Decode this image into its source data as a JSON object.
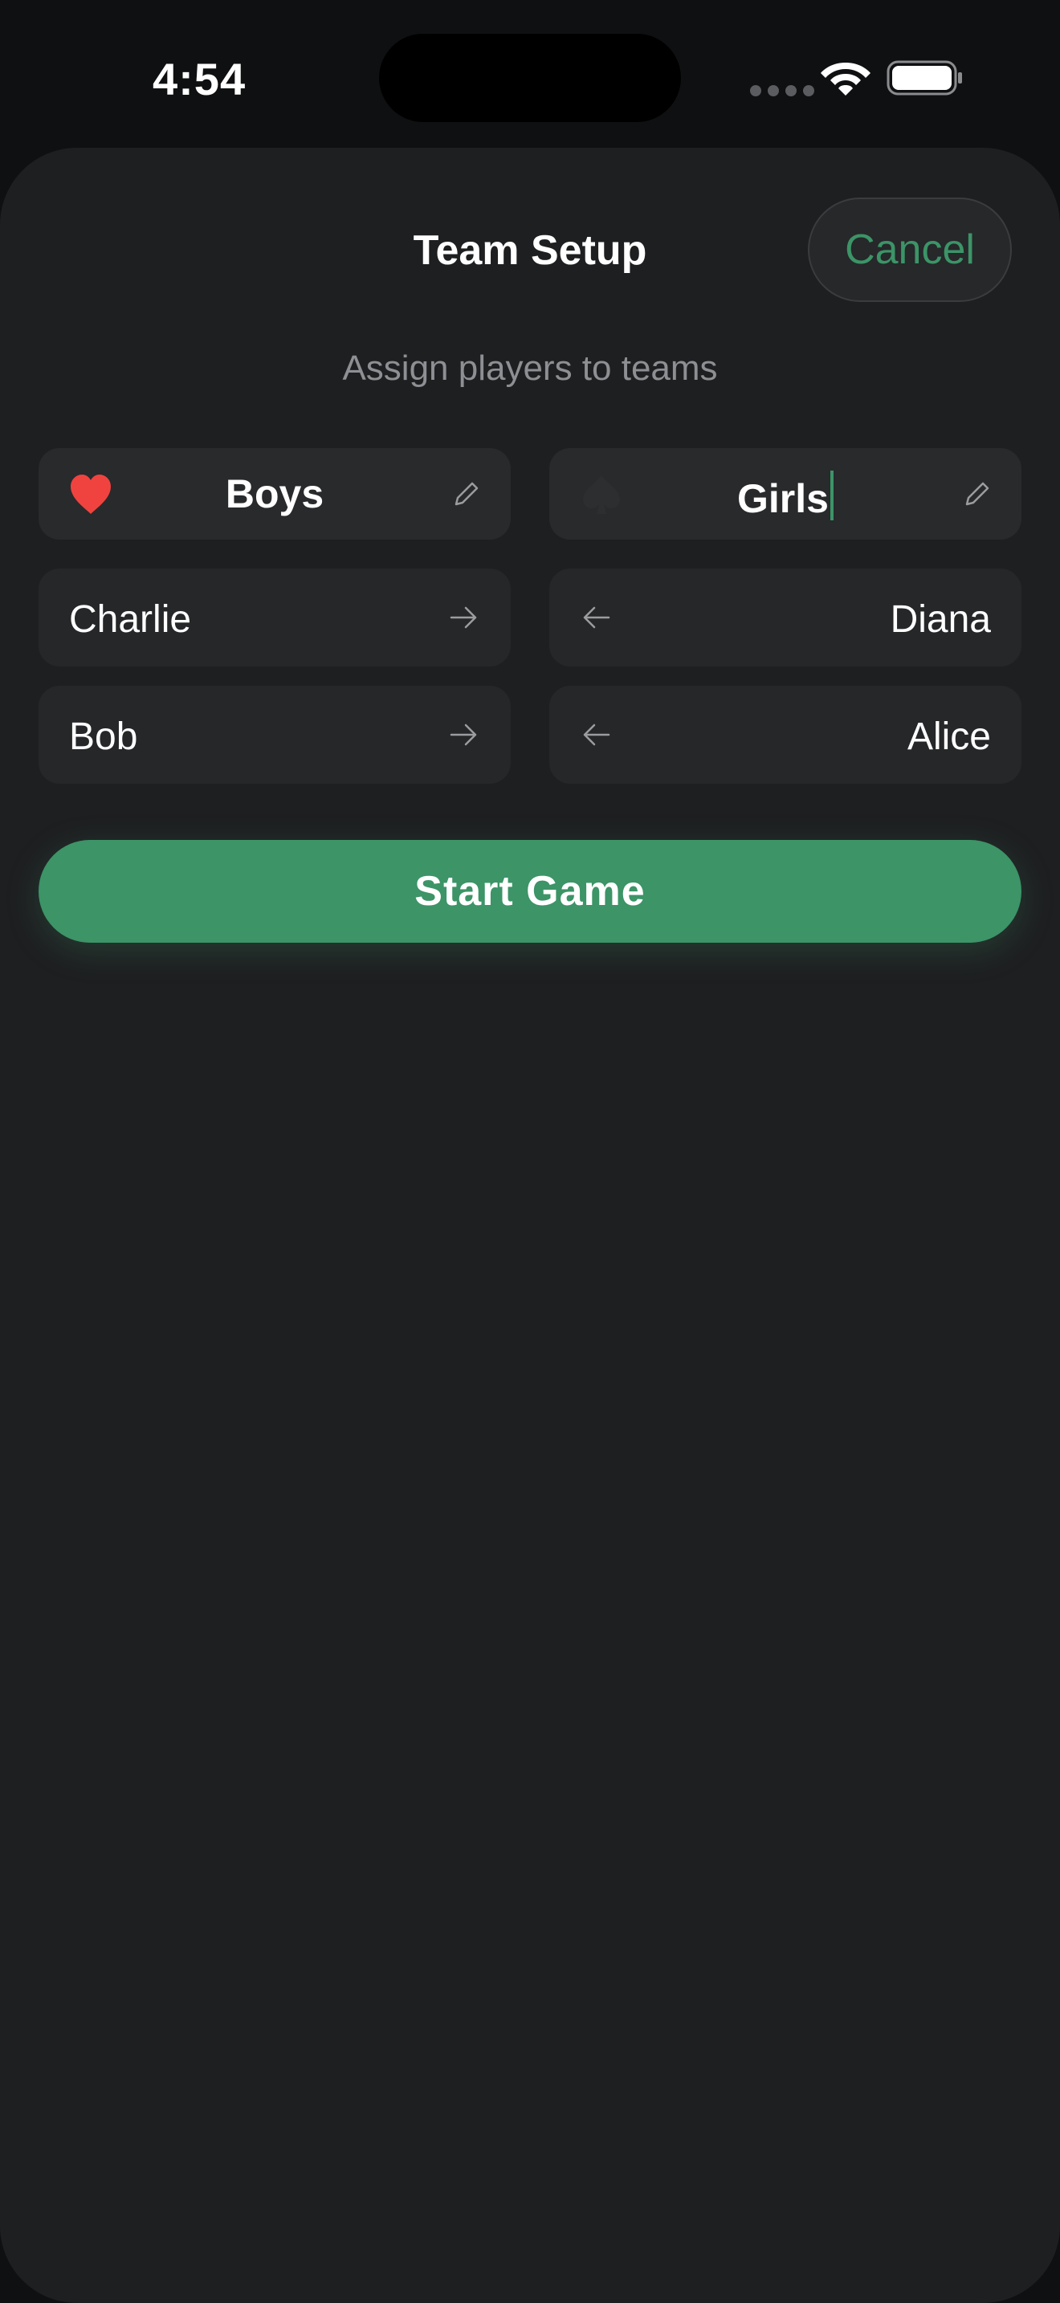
{
  "status_bar": {
    "time": "4:54"
  },
  "sheet": {
    "title": "Team Setup",
    "cancel_label": "Cancel",
    "subtitle": "Assign players to teams"
  },
  "teams": [
    {
      "name": "Boys",
      "suit_icon": "heart-icon",
      "suit_color": "#f0433f"
    },
    {
      "name": "Girls",
      "suit_icon": "spade-icon",
      "suit_color": "#2c2e30"
    }
  ],
  "players": {
    "left": [
      {
        "name": "Charlie"
      },
      {
        "name": "Bob"
      }
    ],
    "right": [
      {
        "name": "Diana"
      },
      {
        "name": "Alice"
      }
    ]
  },
  "start_button_label": "Start Game",
  "colors": {
    "accent": "#3c9467",
    "background": "#0f1011",
    "sheet": "#1e1f21",
    "card": "#252729"
  }
}
